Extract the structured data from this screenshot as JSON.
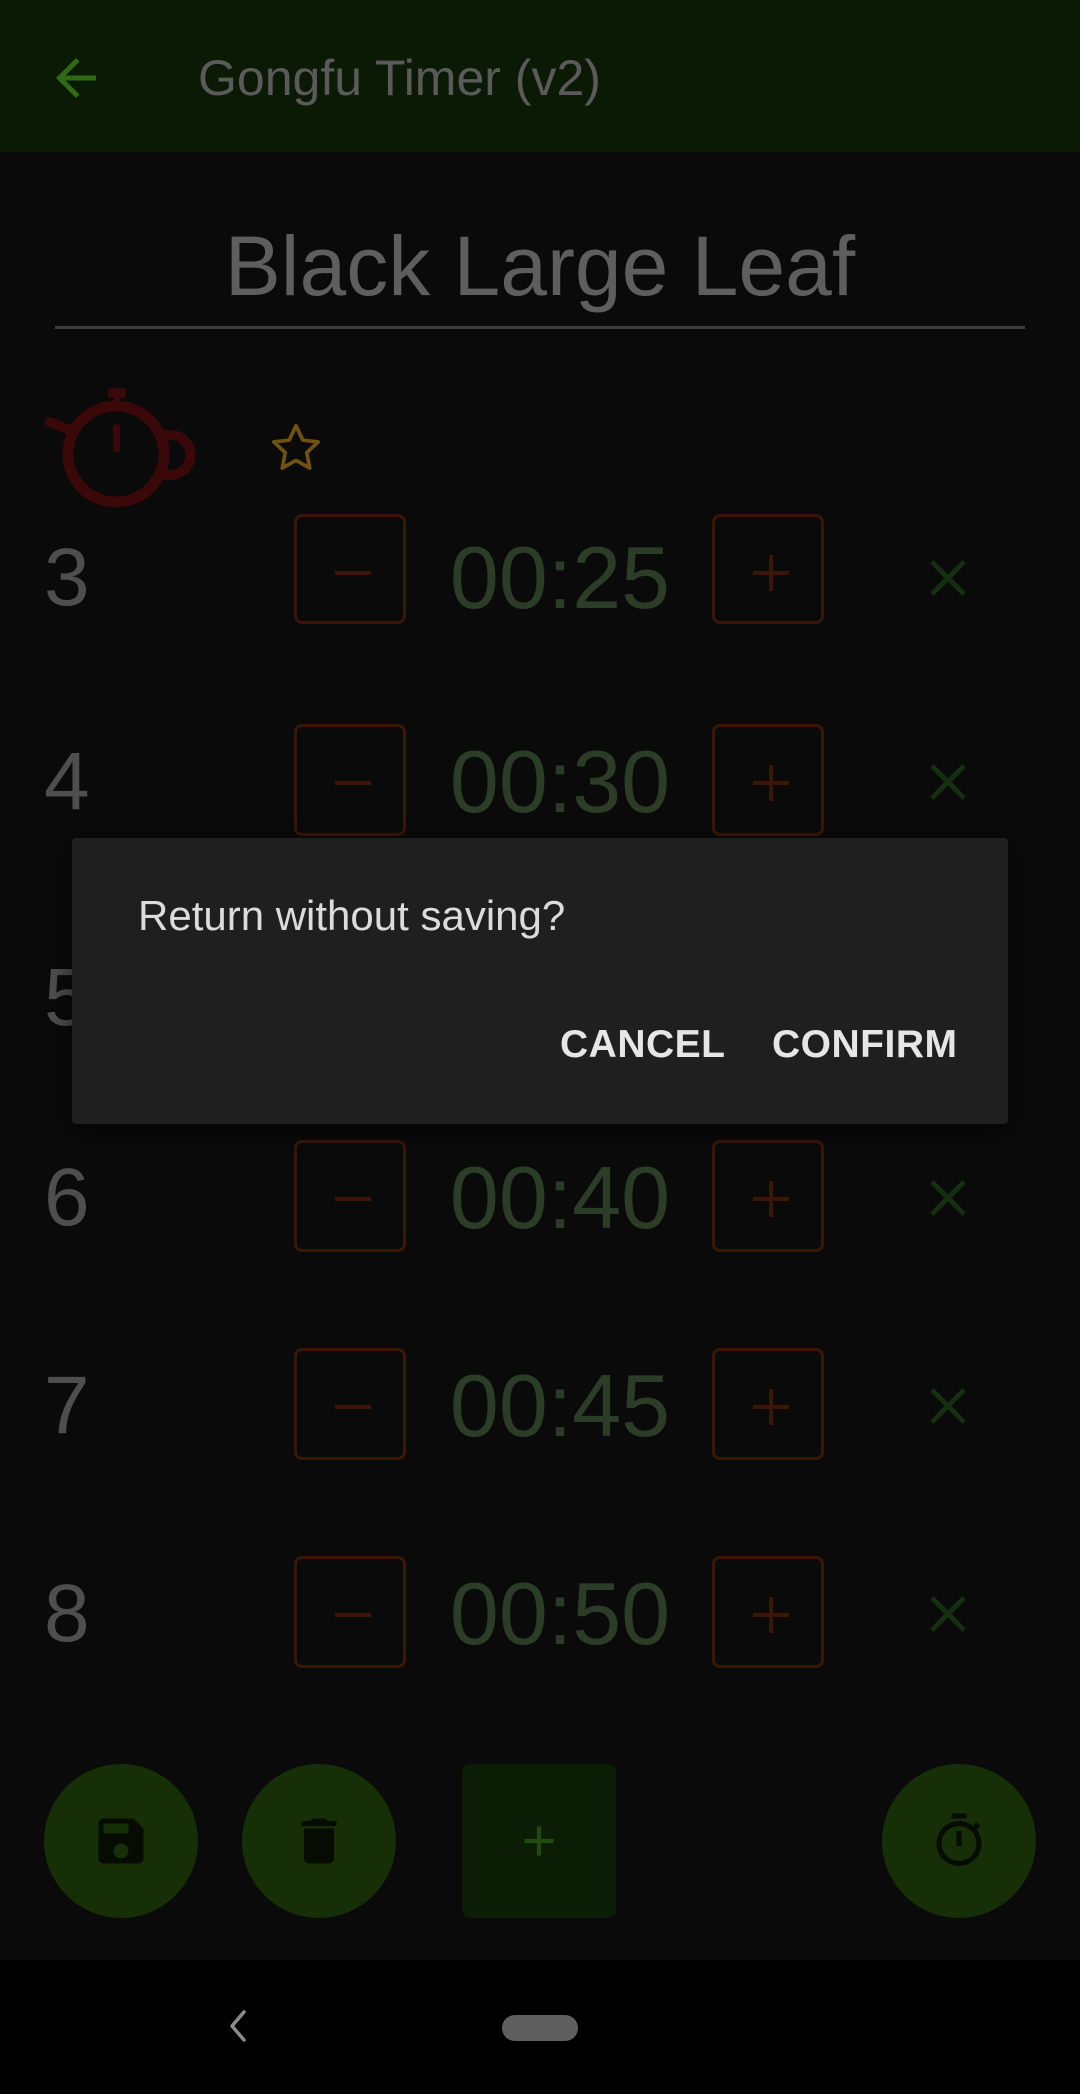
{
  "app": {
    "title": "Gongfu Timer (v2)"
  },
  "tea": {
    "name": "Black Large Leaf"
  },
  "steeps": [
    {
      "number": "3",
      "time": "00:25"
    },
    {
      "number": "4",
      "time": "00:30"
    },
    {
      "number": "5",
      "time": ""
    },
    {
      "number": "6",
      "time": "00:40"
    },
    {
      "number": "7",
      "time": "00:45"
    },
    {
      "number": "8",
      "time": "00:50"
    }
  ],
  "dialog": {
    "message": "Return without saving?",
    "cancel_label": "CANCEL",
    "confirm_label": "CONFIRM"
  },
  "colors": {
    "accent": "#4caf50",
    "appbar": "#0b1a05",
    "timer_red": "#8b1a1a",
    "star": "#c8901a",
    "dialog_bg": "#1f1f1f"
  },
  "icons": {
    "back": "arrow-left-icon",
    "teapot": "teapot-timer-icon",
    "favorite": "star-outline-icon",
    "save": "save-icon",
    "delete": "trash-icon",
    "add": "plus-icon",
    "timer": "stopwatch-icon"
  }
}
